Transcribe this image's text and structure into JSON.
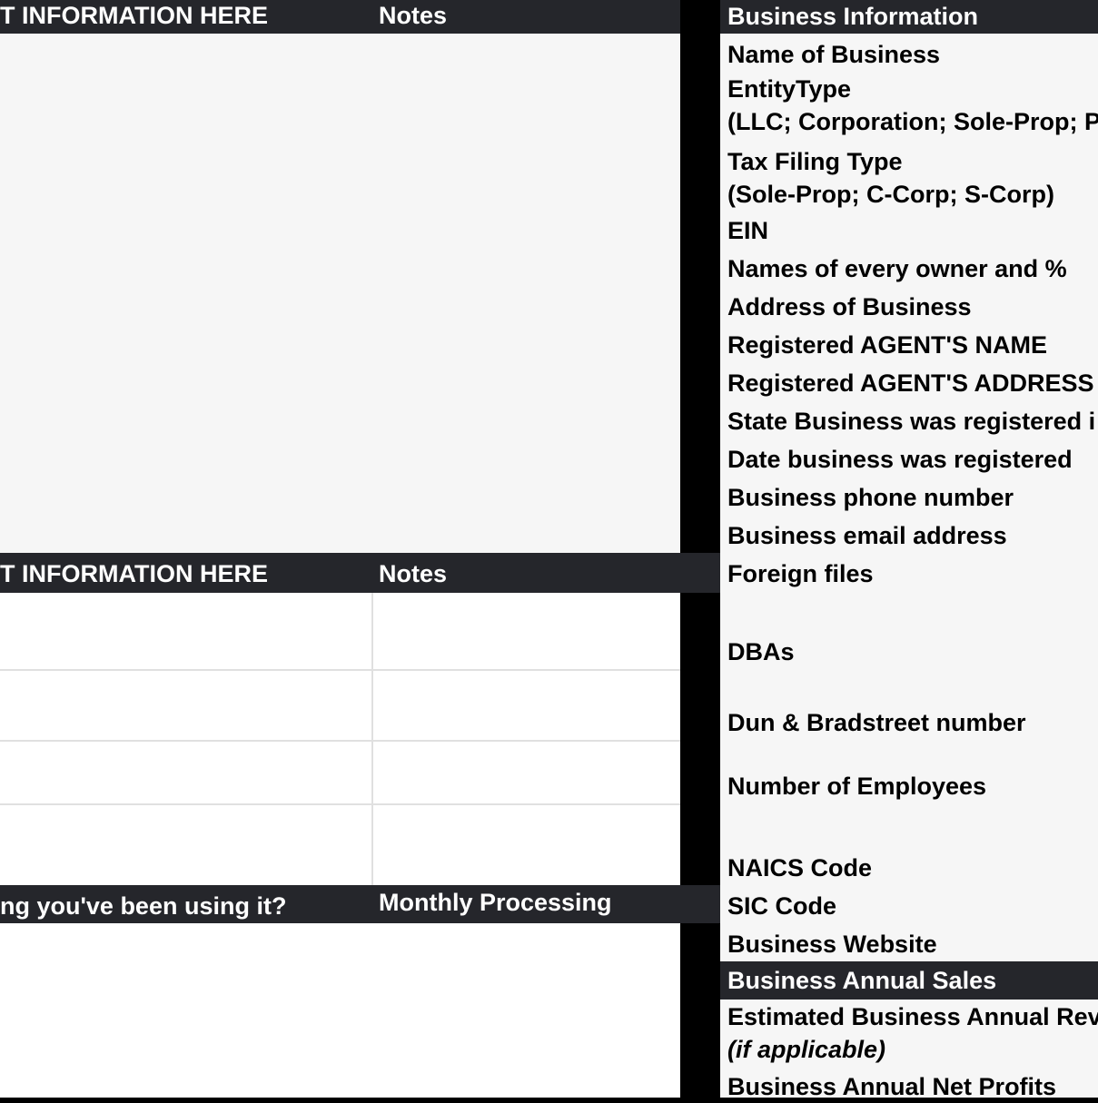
{
  "left_panel": {
    "section1": {
      "header_col1": "T INFORMATION HERE",
      "header_col2": "Notes"
    },
    "section2": {
      "header_col1": "T INFORMATION HERE",
      "header_col2": "Notes",
      "rows": [
        {
          "col1": "",
          "col2": ""
        },
        {
          "col1": "",
          "col2": ""
        },
        {
          "col1": "",
          "col2": ""
        },
        {
          "col1": "",
          "col2": ""
        }
      ]
    },
    "section3": {
      "header_col1": "ng you've been using it?",
      "header_col2": "Monthly Processing"
    }
  },
  "right_panel": {
    "header": "Business Information",
    "fields": [
      {
        "label": "Name of Business"
      },
      {
        "label": "EntityType",
        "sub": "(LLC; Corporation; Sole-Prop; P"
      },
      {
        "label": "Tax Filing Type",
        "sub": "(Sole-Prop; C-Corp; S-Corp)"
      },
      {
        "label": "EIN"
      },
      {
        "label": "Names of every owner and %"
      },
      {
        "label": "Address of Business"
      },
      {
        "label": "Registered AGENT'S NAME"
      },
      {
        "label": "Registered AGENT'S ADDRESS"
      },
      {
        "label": "State Business was registered i"
      },
      {
        "label": "Date business was registered"
      },
      {
        "label": "Business phone number"
      },
      {
        "label": "Business email address"
      },
      {
        "label": "Foreign files"
      },
      {
        "label": "DBAs"
      },
      {
        "label": "Dun & Bradstreet number"
      },
      {
        "label": "Number of Employees"
      },
      {
        "label": "NAICS Code"
      },
      {
        "label": "SIC Code"
      },
      {
        "label": "Business Website"
      }
    ],
    "sales_header": "Business Annual Sales",
    "sales_fields": [
      {
        "label": "Estimated Business Annual Rev",
        "sub": "(if applicable)"
      },
      {
        "label": "Business Annual Net Profits"
      }
    ]
  },
  "colors": {
    "header_bg": "#25262b",
    "pane_light": "#f6f6f6",
    "pane_white": "#ffffff",
    "gutter": "#000000",
    "gridline": "#e0e0e0"
  }
}
